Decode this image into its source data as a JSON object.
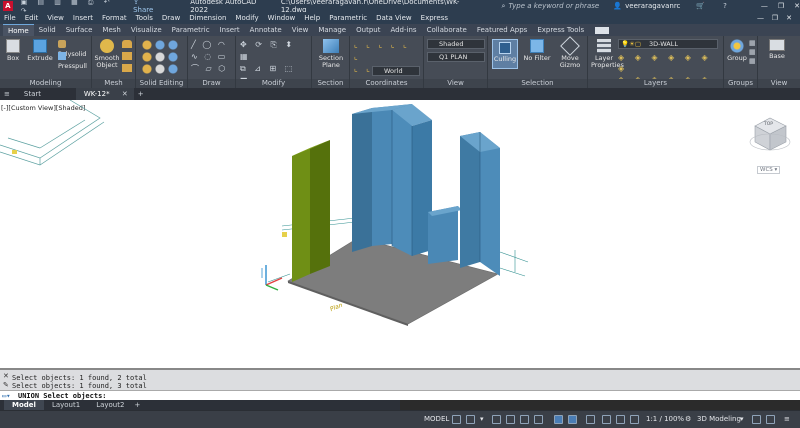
{
  "window": {
    "app_title": "Autodesk AutoCAD 2022",
    "file_path": "C:\\Users\\veeraragavan.r\\OneDrive\\Documents\\WK-12.dwg",
    "search_placeholder": "Type a keyword or phrase",
    "user_name": "veeraragavanrc",
    "share_label": "Share"
  },
  "menu": [
    "File",
    "Edit",
    "View",
    "Insert",
    "Format",
    "Tools",
    "Draw",
    "Dimension",
    "Modify",
    "Window",
    "Help",
    "Parametric",
    "Data View",
    "Express"
  ],
  "ribbon_tabs": [
    "Home",
    "Solid",
    "Surface",
    "Mesh",
    "Visualize",
    "Parametric",
    "Insert",
    "Annotate",
    "View",
    "Manage",
    "Output",
    "Add-ins",
    "Collaborate",
    "Featured Apps",
    "Express Tools"
  ],
  "ribbon": {
    "modeling": {
      "title": "Modeling",
      "box": "Box",
      "extrude": "Extrude",
      "polysolid": "Polysolid",
      "presspull": "Presspull"
    },
    "mesh": {
      "title": "Mesh",
      "smooth": "Smooth Object"
    },
    "solid_editing": {
      "title": "Solid Editing"
    },
    "draw": {
      "title": "Draw"
    },
    "modify": {
      "title": "Modify"
    },
    "section": {
      "title": "Section",
      "section_plane": "Section Plane"
    },
    "coordinates": {
      "title": "Coordinates",
      "ucs_value": "World"
    },
    "view": {
      "title": "View",
      "visual_style": "Shaded",
      "named_view": "Q1 PLAN"
    },
    "selection": {
      "title": "Selection",
      "culling": "Culling",
      "no_filter": "No Filter",
      "move_gizmo": "Move Gizmo"
    },
    "layers": {
      "title": "Layers",
      "layer_properties": "Layer Properties",
      "current_layer": "3D-WALL"
    },
    "groups": {
      "title": "Groups",
      "group": "Group"
    },
    "view2": {
      "title": "View",
      "base": "Base"
    }
  },
  "doc_tabs": [
    "Start",
    "WK-12*"
  ],
  "viewport": {
    "label": "[-][Custom View][Shaded]",
    "viewcube_face": "TOP",
    "wcs": "WCS",
    "floor_text": "Plan"
  },
  "command": {
    "history": [
      "Select objects: 1 found, 2 total",
      "Select objects: 1 found, 3 total"
    ],
    "current": "UNION Select objects:"
  },
  "layout_tabs": [
    "Model",
    "Layout1",
    "Layout2"
  ],
  "status": {
    "model": "MODEL",
    "scale": "1:1 / 100%",
    "workspace": "3D Modeling"
  },
  "colors": {
    "accent": "#6fa8dc",
    "wall_blue": "#3f7aa3",
    "wall_green": "#5c7a12",
    "floor_gray": "#7d7d7d"
  }
}
